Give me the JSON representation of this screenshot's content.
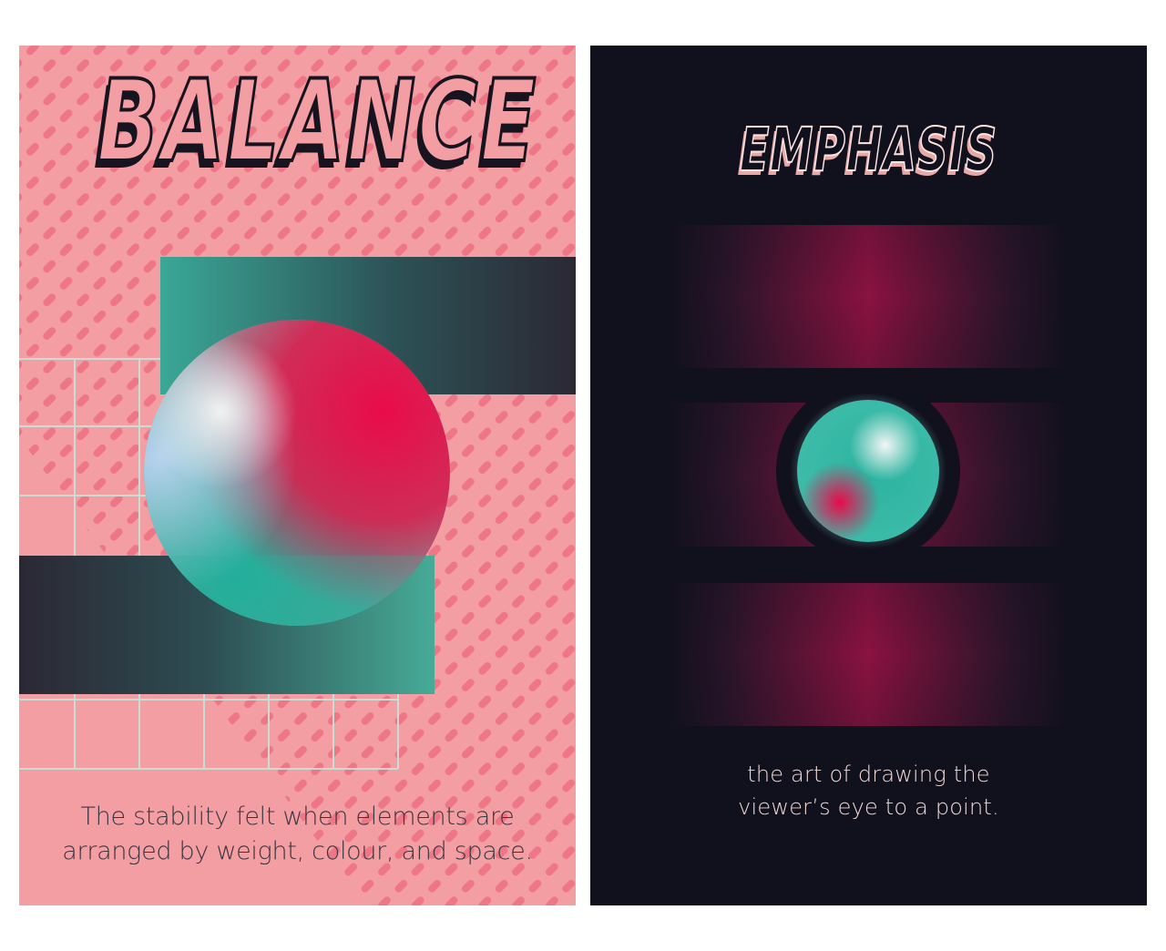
{
  "posters": {
    "balance": {
      "title": "BALANCE",
      "caption_lines": [
        "The stability felt when elements are",
        "arranged by weight, colour, and space."
      ]
    },
    "emphasis": {
      "title": "EMPHASIS",
      "caption_lines": [
        "the art of drawing the",
        "viewer’s eye to a point."
      ]
    }
  },
  "colors": {
    "pink_background": "#f29ea2",
    "dark_navy": "#11101d",
    "teal": "#2bb3a0",
    "crimson": "#e3104f",
    "stripe_pink": "#ee7686",
    "grid_line": "#c9dcd6"
  }
}
